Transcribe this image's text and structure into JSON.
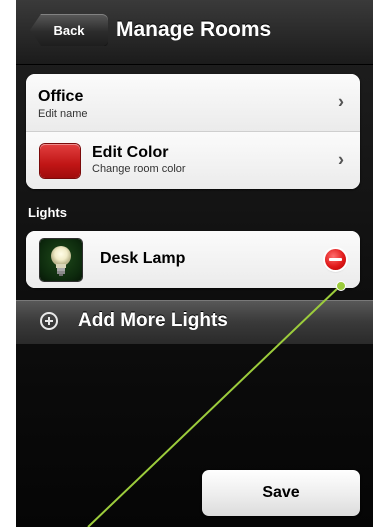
{
  "navbar": {
    "back_label": "Back",
    "title": "Manage Rooms"
  },
  "room": {
    "name": "Office",
    "name_sub": "Edit name",
    "color_title": "Edit Color",
    "color_sub": "Change room color",
    "color_hex": "#c61616"
  },
  "lights_section": {
    "label": "Lights"
  },
  "lights": [
    {
      "name": "Desk Lamp",
      "icon": "bulb-icon"
    }
  ],
  "add_more": {
    "label": "Add More Lights",
    "icon": "plus-circle-icon"
  },
  "save": {
    "label": "Save"
  },
  "annotation": {
    "color": "#9ccc3c"
  }
}
